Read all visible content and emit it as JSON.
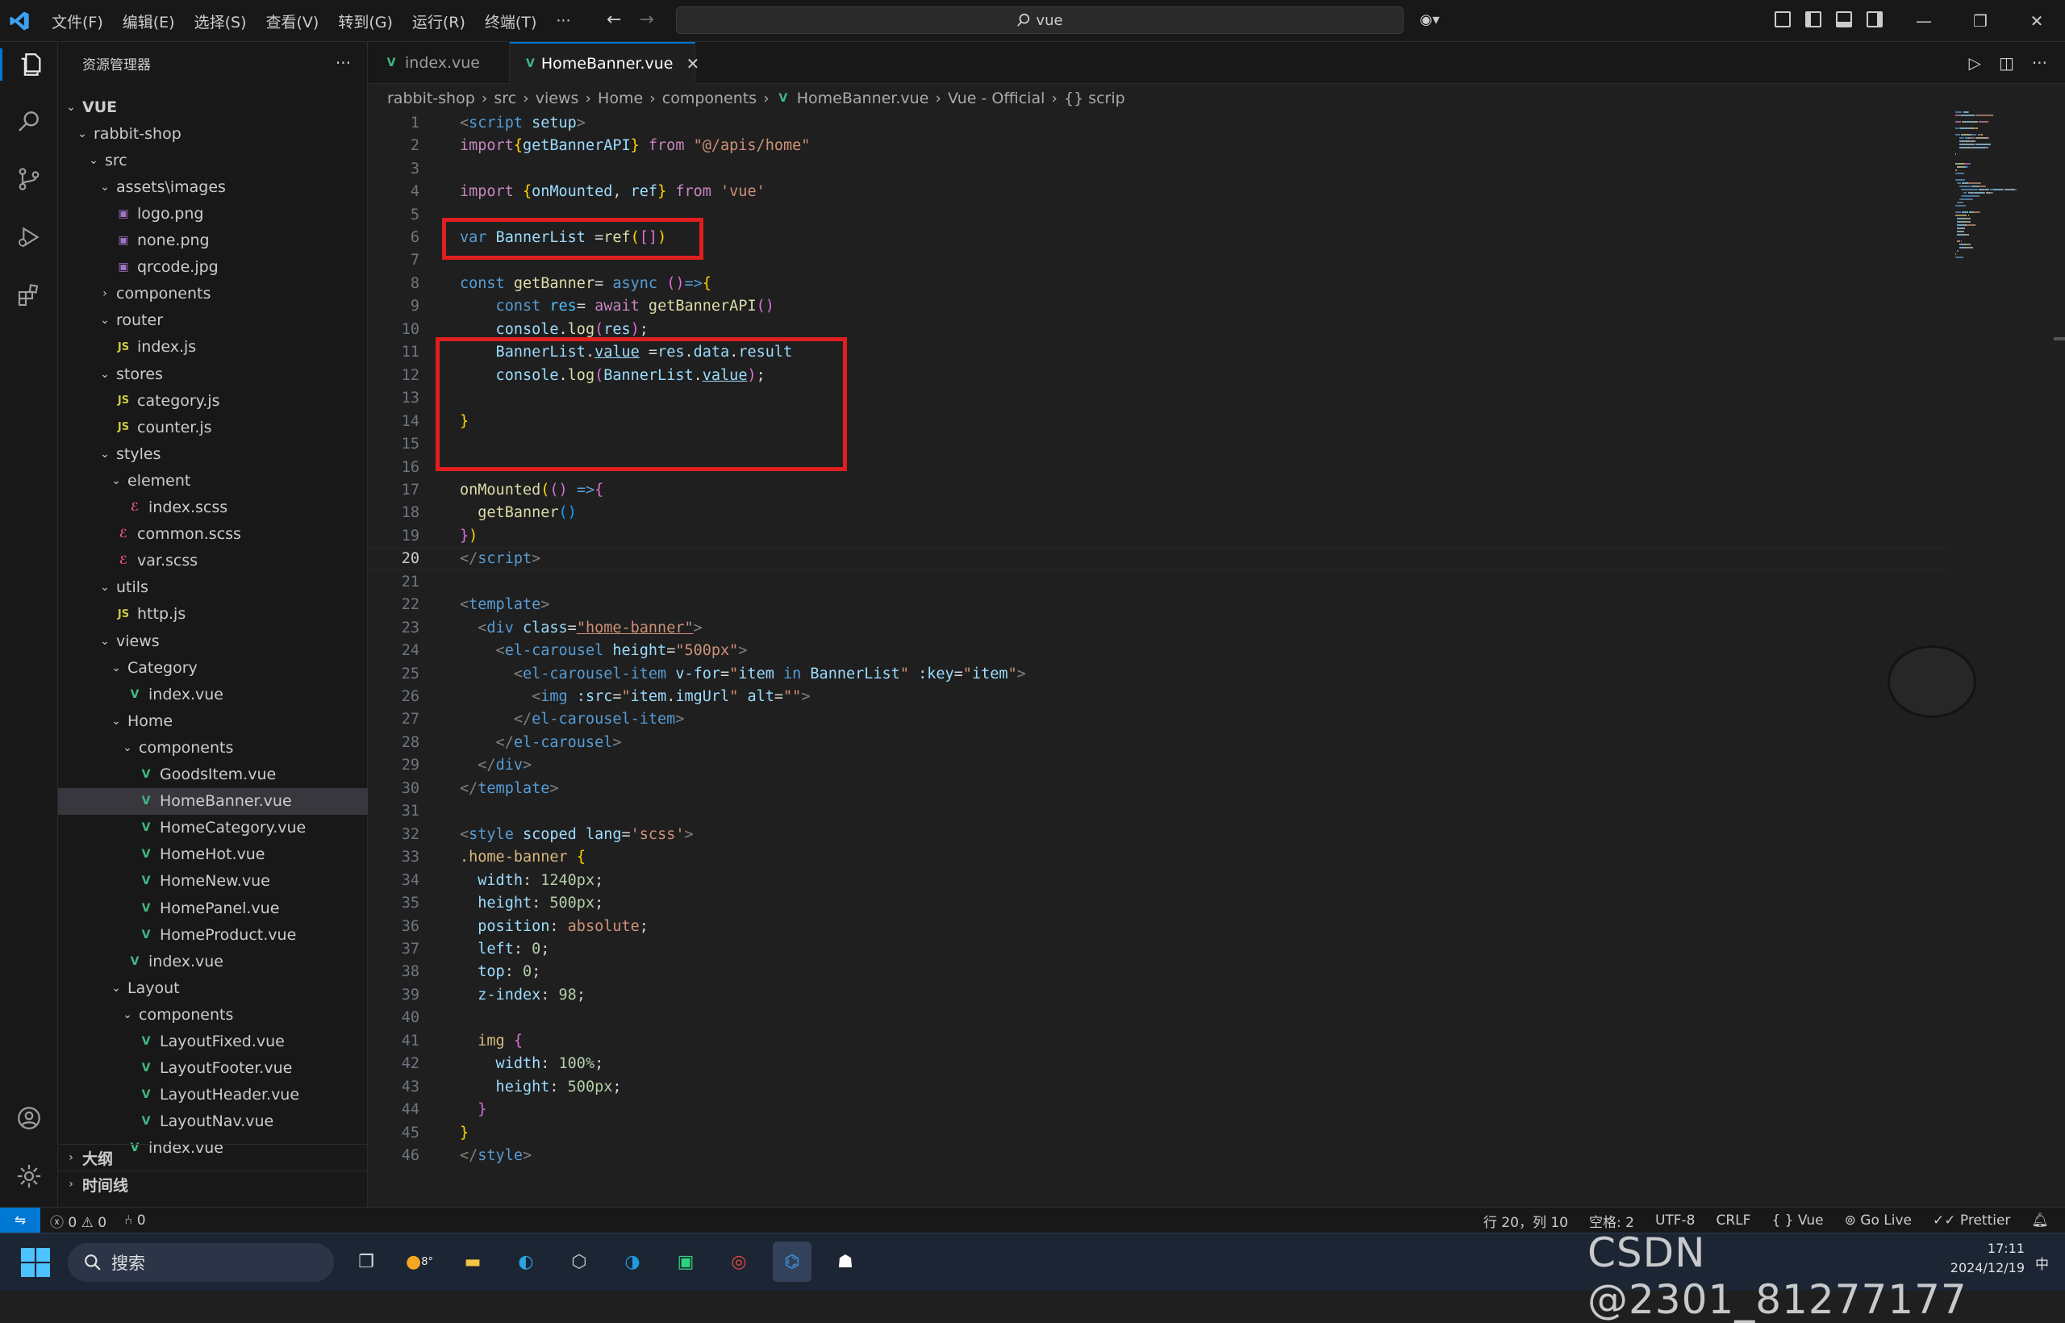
{
  "titlebar": {
    "menu": [
      "文件(F)",
      "编辑(E)",
      "选择(S)",
      "查看(V)",
      "转到(G)",
      "运行(R)",
      "终端(T)",
      "···"
    ],
    "search": "vue"
  },
  "sidebar": {
    "title": "资源管理器",
    "more": "···",
    "tree": [
      {
        "label": "VUE",
        "indent": 0,
        "type": "folder-open",
        "bold": true
      },
      {
        "label": "rabbit-shop",
        "indent": 1,
        "type": "folder-open"
      },
      {
        "label": "src",
        "indent": 2,
        "type": "folder-open"
      },
      {
        "label": "assets\\images",
        "indent": 3,
        "type": "folder-open"
      },
      {
        "label": "logo.png",
        "indent": 4,
        "type": "png"
      },
      {
        "label": "none.png",
        "indent": 4,
        "type": "png"
      },
      {
        "label": "qrcode.jpg",
        "indent": 4,
        "type": "png"
      },
      {
        "label": "components",
        "indent": 3,
        "type": "folder-closed"
      },
      {
        "label": "router",
        "indent": 3,
        "type": "folder-open"
      },
      {
        "label": "index.js",
        "indent": 4,
        "type": "js"
      },
      {
        "label": "stores",
        "indent": 3,
        "type": "folder-open"
      },
      {
        "label": "category.js",
        "indent": 4,
        "type": "js"
      },
      {
        "label": "counter.js",
        "indent": 4,
        "type": "js"
      },
      {
        "label": "styles",
        "indent": 3,
        "type": "folder-open"
      },
      {
        "label": "element",
        "indent": 4,
        "type": "folder-open"
      },
      {
        "label": "index.scss",
        "indent": 5,
        "type": "scss"
      },
      {
        "label": "common.scss",
        "indent": 4,
        "type": "scss"
      },
      {
        "label": "var.scss",
        "indent": 4,
        "type": "scss"
      },
      {
        "label": "utils",
        "indent": 3,
        "type": "folder-open"
      },
      {
        "label": "http.js",
        "indent": 4,
        "type": "js"
      },
      {
        "label": "views",
        "indent": 3,
        "type": "folder-open"
      },
      {
        "label": "Category",
        "indent": 4,
        "type": "folder-open"
      },
      {
        "label": "index.vue",
        "indent": 5,
        "type": "vue"
      },
      {
        "label": "Home",
        "indent": 4,
        "type": "folder-open"
      },
      {
        "label": "components",
        "indent": 5,
        "type": "folder-open"
      },
      {
        "label": "GoodsItem.vue",
        "indent": 6,
        "type": "vue"
      },
      {
        "label": "HomeBanner.vue",
        "indent": 6,
        "type": "vue",
        "selected": true
      },
      {
        "label": "HomeCategory.vue",
        "indent": 6,
        "type": "vue"
      },
      {
        "label": "HomeHot.vue",
        "indent": 6,
        "type": "vue"
      },
      {
        "label": "HomeNew.vue",
        "indent": 6,
        "type": "vue"
      },
      {
        "label": "HomePanel.vue",
        "indent": 6,
        "type": "vue"
      },
      {
        "label": "HomeProduct.vue",
        "indent": 6,
        "type": "vue"
      },
      {
        "label": "index.vue",
        "indent": 5,
        "type": "vue"
      },
      {
        "label": "Layout",
        "indent": 4,
        "type": "folder-open"
      },
      {
        "label": "components",
        "indent": 5,
        "type": "folder-open"
      },
      {
        "label": "LayoutFixed.vue",
        "indent": 6,
        "type": "vue"
      },
      {
        "label": "LayoutFooter.vue",
        "indent": 6,
        "type": "vue"
      },
      {
        "label": "LayoutHeader.vue",
        "indent": 6,
        "type": "vue"
      },
      {
        "label": "LayoutNav.vue",
        "indent": 6,
        "type": "vue"
      },
      {
        "label": "index.vue",
        "indent": 5,
        "type": "vue"
      }
    ],
    "sections": [
      "大纲",
      "时间线"
    ]
  },
  "tabs": [
    {
      "label": "index.vue",
      "active": false
    },
    {
      "label": "HomeBanner.vue",
      "active": true,
      "close": "✕"
    }
  ],
  "breadcrumb": [
    "rabbit-shop",
    "src",
    "views",
    "Home",
    "components",
    "HomeBanner.vue",
    "Vue - Official",
    "{} scrip"
  ],
  "editor": {
    "current_line": 20,
    "lines": [
      [
        [
          "<",
          "#808080"
        ],
        [
          "script",
          "#569cd6"
        ],
        [
          " setup",
          "#9cdcfe"
        ],
        [
          ">",
          "#808080"
        ]
      ],
      [
        [
          "import",
          "#c586c0"
        ],
        [
          "{",
          "#ffd700"
        ],
        [
          "getBannerAPI",
          "#9cdcfe"
        ],
        [
          "}",
          "#ffd700"
        ],
        [
          " from ",
          "#c586c0"
        ],
        [
          "\"@/apis/home\"",
          "#ce9178"
        ]
      ],
      [],
      [
        [
          "import",
          "#c586c0"
        ],
        [
          " {",
          "#ffd700"
        ],
        [
          "onMounted",
          "#9cdcfe"
        ],
        [
          ", ",
          "#cccccc"
        ],
        [
          "ref",
          "#9cdcfe"
        ],
        [
          "}",
          "#ffd700"
        ],
        [
          " from ",
          "#c586c0"
        ],
        [
          "'vue'",
          "#ce9178"
        ]
      ],
      [],
      [
        [
          "var",
          "#569cd6"
        ],
        [
          " BannerList ",
          "#9cdcfe"
        ],
        [
          "=",
          "#d4d4d4"
        ],
        [
          "ref",
          "#dcdcaa"
        ],
        [
          "(",
          "#ffd700"
        ],
        [
          "[]",
          "#da70d6"
        ],
        [
          ")",
          "#ffd700"
        ]
      ],
      [],
      [
        [
          "const",
          "#569cd6"
        ],
        [
          " getBanner",
          "#dcdcaa"
        ],
        [
          "= ",
          "#d4d4d4"
        ],
        [
          "async",
          "#569cd6"
        ],
        [
          " ()",
          "#da70d6"
        ],
        [
          "=>",
          "#569cd6"
        ],
        [
          "{",
          "#ffd700"
        ]
      ],
      [
        [
          "    const",
          "#569cd6"
        ],
        [
          " res",
          "#4fc1ff"
        ],
        [
          "= ",
          "#d4d4d4"
        ],
        [
          "await",
          "#c586c0"
        ],
        [
          " getBannerAPI",
          "#dcdcaa"
        ],
        [
          "()",
          "#da70d6"
        ]
      ],
      [
        [
          "    console",
          "#9cdcfe"
        ],
        [
          ".",
          "#d4d4d4"
        ],
        [
          "log",
          "#dcdcaa"
        ],
        [
          "(",
          "#da70d6"
        ],
        [
          "res",
          "#9cdcfe"
        ],
        [
          ")",
          "#da70d6"
        ],
        [
          ";",
          "#d4d4d4"
        ]
      ],
      [
        [
          "    BannerList",
          "#9cdcfe"
        ],
        [
          ".",
          "#d4d4d4"
        ],
        [
          "value",
          "#9cdcfe"
        ],
        [
          " =",
          "#d4d4d4"
        ],
        [
          "res",
          "#9cdcfe"
        ],
        [
          ".",
          "#d4d4d4"
        ],
        [
          "data",
          "#9cdcfe"
        ],
        [
          ".",
          "#d4d4d4"
        ],
        [
          "result",
          "#9cdcfe"
        ]
      ],
      [
        [
          "    console",
          "#9cdcfe"
        ],
        [
          ".",
          "#d4d4d4"
        ],
        [
          "log",
          "#dcdcaa"
        ],
        [
          "(",
          "#da70d6"
        ],
        [
          "BannerList",
          "#9cdcfe"
        ],
        [
          ".",
          "#d4d4d4"
        ],
        [
          "value",
          "#9cdcfe"
        ],
        [
          ")",
          "#da70d6"
        ],
        [
          ";",
          "#d4d4d4"
        ]
      ],
      [],
      [
        [
          "}",
          "#ffd700"
        ]
      ],
      [],
      [],
      [
        [
          "onMounted",
          "#dcdcaa"
        ],
        [
          "(",
          "#ffd700"
        ],
        [
          "() ",
          "#da70d6"
        ],
        [
          "=>",
          "#569cd6"
        ],
        [
          "{",
          "#da70d6"
        ]
      ],
      [
        [
          "  getBanner",
          "#dcdcaa"
        ],
        [
          "()",
          "#179fff"
        ]
      ],
      [
        [
          "}",
          "#da70d6"
        ],
        [
          ")",
          "#ffd700"
        ]
      ],
      [
        [
          "</",
          "#808080"
        ],
        [
          "script",
          "#569cd6"
        ],
        [
          ">",
          "#808080"
        ]
      ],
      [],
      [
        [
          "<",
          "#808080"
        ],
        [
          "template",
          "#569cd6"
        ],
        [
          ">",
          "#808080"
        ]
      ],
      [
        [
          "  <",
          "#808080"
        ],
        [
          "div",
          "#569cd6"
        ],
        [
          " class",
          "#9cdcfe"
        ],
        [
          "=",
          "#d4d4d4"
        ],
        [
          "\"home-banner\"",
          "#ce9178"
        ],
        [
          ">",
          "#808080"
        ]
      ],
      [
        [
          "    <",
          "#808080"
        ],
        [
          "el-carousel",
          "#569cd6"
        ],
        [
          " height",
          "#9cdcfe"
        ],
        [
          "=",
          "#d4d4d4"
        ],
        [
          "\"500px\"",
          "#ce9178"
        ],
        [
          ">",
          "#808080"
        ]
      ],
      [
        [
          "      <",
          "#808080"
        ],
        [
          "el-carousel-item",
          "#569cd6"
        ],
        [
          " v-for",
          "#9cdcfe"
        ],
        [
          "=",
          "#d4d4d4"
        ],
        [
          "\"",
          "#ce9178"
        ],
        [
          "item",
          "#9cdcfe"
        ],
        [
          " in ",
          "#569cd6"
        ],
        [
          "BannerList",
          "#9cdcfe"
        ],
        [
          "\"",
          "#ce9178"
        ],
        [
          " :key",
          "#9cdcfe"
        ],
        [
          "=",
          "#d4d4d4"
        ],
        [
          "\"",
          "#ce9178"
        ],
        [
          "item",
          "#9cdcfe"
        ],
        [
          "\"",
          "#ce9178"
        ],
        [
          ">",
          "#808080"
        ]
      ],
      [
        [
          "        <",
          "#808080"
        ],
        [
          "img",
          "#569cd6"
        ],
        [
          " :src",
          "#9cdcfe"
        ],
        [
          "=",
          "#d4d4d4"
        ],
        [
          "\"",
          "#ce9178"
        ],
        [
          "item",
          "#9cdcfe"
        ],
        [
          ".",
          "#d4d4d4"
        ],
        [
          "imgUrl",
          "#9cdcfe"
        ],
        [
          "\"",
          "#ce9178"
        ],
        [
          " alt",
          "#9cdcfe"
        ],
        [
          "=",
          "#d4d4d4"
        ],
        [
          "\"\"",
          "#ce9178"
        ],
        [
          ">",
          "#808080"
        ]
      ],
      [
        [
          "      </",
          "#808080"
        ],
        [
          "el-carousel-item",
          "#569cd6"
        ],
        [
          ">",
          "#808080"
        ]
      ],
      [
        [
          "    </",
          "#808080"
        ],
        [
          "el-carousel",
          "#569cd6"
        ],
        [
          ">",
          "#808080"
        ]
      ],
      [
        [
          "  </",
          "#808080"
        ],
        [
          "div",
          "#569cd6"
        ],
        [
          ">",
          "#808080"
        ]
      ],
      [
        [
          "</",
          "#808080"
        ],
        [
          "template",
          "#569cd6"
        ],
        [
          ">",
          "#808080"
        ]
      ],
      [],
      [
        [
          "<",
          "#808080"
        ],
        [
          "style",
          "#569cd6"
        ],
        [
          " scoped",
          "#9cdcfe"
        ],
        [
          " lang",
          "#9cdcfe"
        ],
        [
          "=",
          "#d4d4d4"
        ],
        [
          "'scss'",
          "#ce9178"
        ],
        [
          ">",
          "#808080"
        ]
      ],
      [
        [
          ".home-banner",
          "#d7ba7d"
        ],
        [
          " {",
          "#ffd700"
        ]
      ],
      [
        [
          "  width",
          "#9cdcfe"
        ],
        [
          ": ",
          "#d4d4d4"
        ],
        [
          "1240px",
          "#b5cea8"
        ],
        [
          ";",
          "#d4d4d4"
        ]
      ],
      [
        [
          "  height",
          "#9cdcfe"
        ],
        [
          ": ",
          "#d4d4d4"
        ],
        [
          "500px",
          "#b5cea8"
        ],
        [
          ";",
          "#d4d4d4"
        ]
      ],
      [
        [
          "  position",
          "#9cdcfe"
        ],
        [
          ": ",
          "#d4d4d4"
        ],
        [
          "absolute",
          "#ce9178"
        ],
        [
          ";",
          "#d4d4d4"
        ]
      ],
      [
        [
          "  left",
          "#9cdcfe"
        ],
        [
          ": ",
          "#d4d4d4"
        ],
        [
          "0",
          "#b5cea8"
        ],
        [
          ";",
          "#d4d4d4"
        ]
      ],
      [
        [
          "  top",
          "#9cdcfe"
        ],
        [
          ": ",
          "#d4d4d4"
        ],
        [
          "0",
          "#b5cea8"
        ],
        [
          ";",
          "#d4d4d4"
        ]
      ],
      [
        [
          "  z-index",
          "#9cdcfe"
        ],
        [
          ": ",
          "#d4d4d4"
        ],
        [
          "98",
          "#b5cea8"
        ],
        [
          ";",
          "#d4d4d4"
        ]
      ],
      [],
      [
        [
          "  img",
          "#d7ba7d"
        ],
        [
          " {",
          "#da70d6"
        ]
      ],
      [
        [
          "    width",
          "#9cdcfe"
        ],
        [
          ": ",
          "#d4d4d4"
        ],
        [
          "100%",
          "#b5cea8"
        ],
        [
          ";",
          "#d4d4d4"
        ]
      ],
      [
        [
          "    height",
          "#9cdcfe"
        ],
        [
          ": ",
          "#d4d4d4"
        ],
        [
          "500px",
          "#b5cea8"
        ],
        [
          ";",
          "#d4d4d4"
        ]
      ],
      [
        [
          "  }",
          "#da70d6"
        ]
      ],
      [
        [
          "}",
          "#ffd700"
        ]
      ],
      [
        [
          "</",
          "#808080"
        ],
        [
          "style",
          "#569cd6"
        ],
        [
          ">",
          "#808080"
        ]
      ]
    ]
  },
  "statusbar": {
    "errors": "0",
    "warnings": "0",
    "ports": "0",
    "position": "行 20，列 10",
    "spaces": "空格: 2",
    "encoding": "UTF-8",
    "eol": "CRLF",
    "language": "Vue",
    "golive": "Go Live",
    "prettier": "Prettier"
  },
  "taskbar": {
    "search": "搜索",
    "tray_lang": "中",
    "time": "17:11",
    "date": "2024/12/19",
    "weather": "8°"
  },
  "watermark": "CSDN @2301_81277177",
  "colors": {
    "accent": "#0078d4",
    "highlight_box": "#e01e1e",
    "vue": "#41b883"
  }
}
